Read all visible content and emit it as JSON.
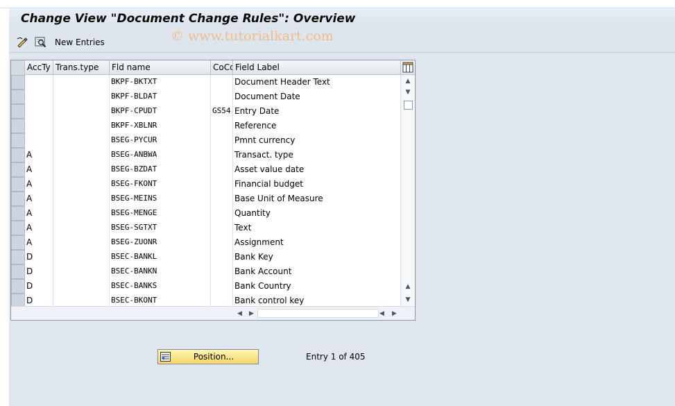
{
  "title": "Change View \"Document Change Rules\": Overview",
  "watermark": "© www.tutorialkart.com",
  "toolbar": {
    "new_entries_label": "New Entries",
    "icons": [
      "change-display-icon",
      "find-icon"
    ]
  },
  "table": {
    "columns": [
      "AccTy",
      "Trans.type",
      "Fld name",
      "CoCd",
      "Field Label"
    ],
    "rows": [
      {
        "accty": "",
        "trans_type": "",
        "fld_name": "BKPF-BKTXT",
        "cocd": "",
        "field_label": "Document Header Text"
      },
      {
        "accty": "",
        "trans_type": "",
        "fld_name": "BKPF-BLDAT",
        "cocd": "",
        "field_label": "Document Date"
      },
      {
        "accty": "",
        "trans_type": "",
        "fld_name": "BKPF-CPUDT",
        "cocd": "GS54",
        "field_label": "Entry Date"
      },
      {
        "accty": "",
        "trans_type": "",
        "fld_name": "BKPF-XBLNR",
        "cocd": "",
        "field_label": "Reference"
      },
      {
        "accty": "",
        "trans_type": "",
        "fld_name": "BSEG-PYCUR",
        "cocd": "",
        "field_label": "Pmnt currency"
      },
      {
        "accty": "A",
        "trans_type": "",
        "fld_name": "BSEG-ANBWA",
        "cocd": "",
        "field_label": "Transact. type"
      },
      {
        "accty": "A",
        "trans_type": "",
        "fld_name": "BSEG-BZDAT",
        "cocd": "",
        "field_label": "Asset value date"
      },
      {
        "accty": "A",
        "trans_type": "",
        "fld_name": "BSEG-FKONT",
        "cocd": "",
        "field_label": "Financial budget"
      },
      {
        "accty": "A",
        "trans_type": "",
        "fld_name": "BSEG-MEINS",
        "cocd": "",
        "field_label": "Base Unit of Measure"
      },
      {
        "accty": "A",
        "trans_type": "",
        "fld_name": "BSEG-MENGE",
        "cocd": "",
        "field_label": "Quantity"
      },
      {
        "accty": "A",
        "trans_type": "",
        "fld_name": "BSEG-SGTXT",
        "cocd": "",
        "field_label": "Text"
      },
      {
        "accty": "A",
        "trans_type": "",
        "fld_name": "BSEG-ZUONR",
        "cocd": "",
        "field_label": "Assignment"
      },
      {
        "accty": "D",
        "trans_type": "",
        "fld_name": "BSEC-BANKL",
        "cocd": "",
        "field_label": "Bank Key"
      },
      {
        "accty": "D",
        "trans_type": "",
        "fld_name": "BSEC-BANKN",
        "cocd": "",
        "field_label": "Bank Account"
      },
      {
        "accty": "D",
        "trans_type": "",
        "fld_name": "BSEC-BANKS",
        "cocd": "",
        "field_label": "Bank Country"
      },
      {
        "accty": "D",
        "trans_type": "",
        "fld_name": "BSEC-BKONT",
        "cocd": "",
        "field_label": "Bank control key"
      }
    ]
  },
  "position_button_label": "Position...",
  "entry_text": "Entry 1 of 405"
}
